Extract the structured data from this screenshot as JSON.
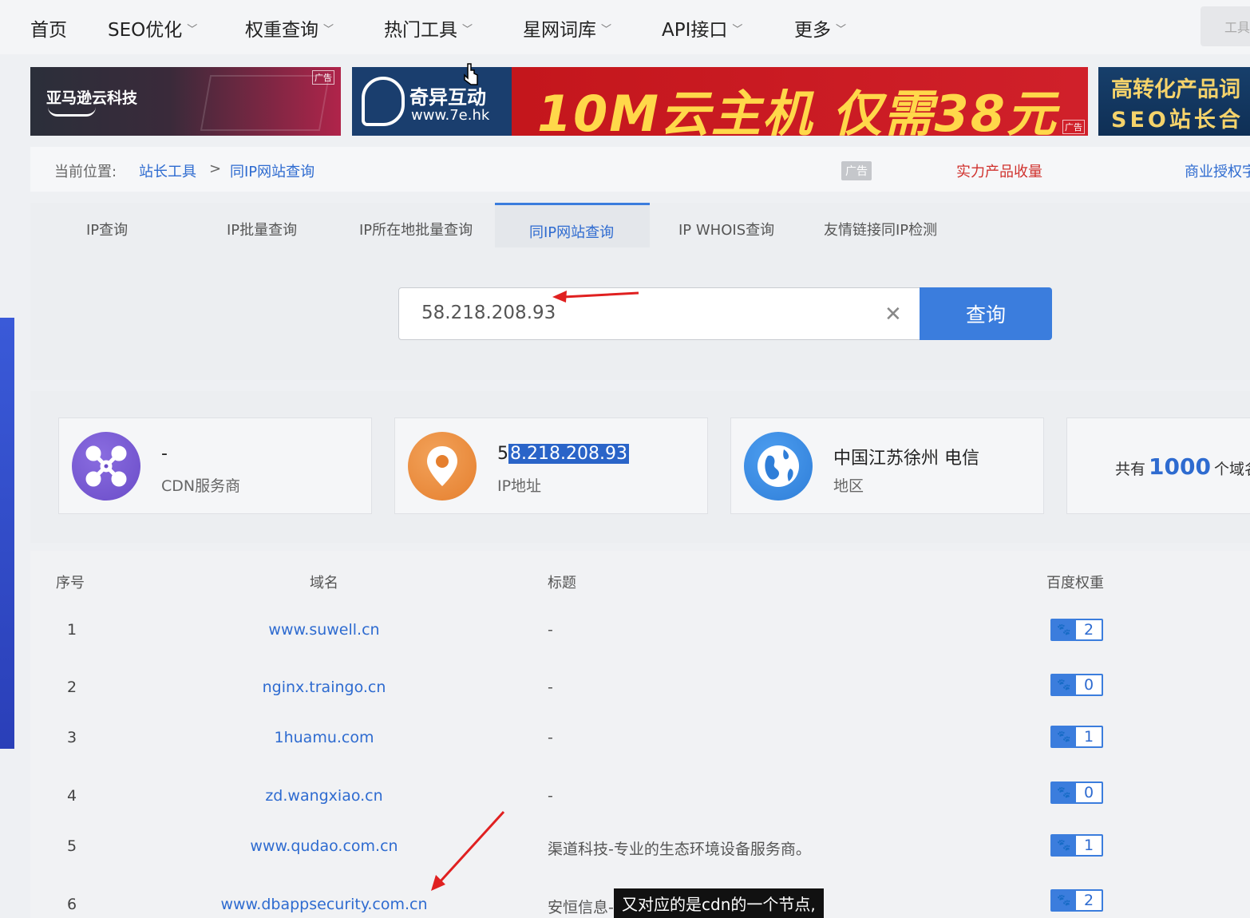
{
  "nav": {
    "items": [
      {
        "label": "首页",
        "has_dropdown": false
      },
      {
        "label": "SEO优化",
        "has_dropdown": true
      },
      {
        "label": "权重查询",
        "has_dropdown": true
      },
      {
        "label": "热门工具",
        "has_dropdown": true
      },
      {
        "label": "星网词库",
        "has_dropdown": true
      },
      {
        "label": "API接口",
        "has_dropdown": true
      },
      {
        "label": "更多",
        "has_dropdown": true
      }
    ],
    "tools_label": "工具"
  },
  "ads": {
    "amazon": {
      "brand": "亚马逊云科技",
      "tag": "广告"
    },
    "qiyi": {
      "logo_text": "奇异互动",
      "url": "www.7e.hk",
      "headline": "10M云主机 仅需38元",
      "tag": "广告"
    },
    "seo": {
      "line1": "高转化产品词",
      "line2": "SEO站长合"
    }
  },
  "breadcrumb": {
    "label": "当前位置:",
    "items": [
      "站长工具",
      "同IP网站查询"
    ],
    "separator": ">",
    "ad_tag": "广告",
    "promo": "实力产品收量",
    "biz": "商业授权字"
  },
  "tabs": [
    {
      "label": "IP查询",
      "active": false
    },
    {
      "label": "IP批量查询",
      "active": false
    },
    {
      "label": "IP所在地批量查询",
      "active": false
    },
    {
      "label": "同IP网站查询",
      "active": true
    },
    {
      "label": "IP WHOIS查询",
      "active": false
    },
    {
      "label": "友情链接同IP检测",
      "active": false
    }
  ],
  "search": {
    "value": "58.218.208.93",
    "button_label": "查询"
  },
  "cards": {
    "cdn": {
      "value": "-",
      "label": "CDN服务商"
    },
    "ip": {
      "value_prefix": "5",
      "value_highlight": "8.218.208.93",
      "label": "IP地址"
    },
    "region": {
      "value": "中国江苏徐州 电信",
      "label": "地区"
    },
    "count": {
      "prefix": "共有",
      "number": "1000",
      "suffix": "个域名"
    }
  },
  "table": {
    "headers": {
      "index": "序号",
      "domain": "域名",
      "title": "标题",
      "weight": "百度权重"
    },
    "rows": [
      {
        "index": "1",
        "domain": "www.suwell.cn",
        "title": "-",
        "weight": "2"
      },
      {
        "index": "2",
        "domain": "nginx.traingo.cn",
        "title": "-",
        "weight": "0"
      },
      {
        "index": "3",
        "domain": "1huamu.com",
        "title": "-",
        "weight": "1"
      },
      {
        "index": "4",
        "domain": "zd.wangxiao.cn",
        "title": "-",
        "weight": "0"
      },
      {
        "index": "5",
        "domain": "www.qudao.com.cn",
        "title": "渠道科技-专业的生态环境设备服务商。",
        "weight": "1"
      },
      {
        "index": "6",
        "domain": "www.dbappsecurity.com.cn",
        "title": "安恒信息-数据安全,云安全,物联网安全",
        "weight": "2"
      }
    ]
  },
  "subtitle": "又对应的是cdn的一个节点,",
  "colors": {
    "accent": "#3b7ddd",
    "link": "#2e6bd0",
    "promo": "#d0312d"
  }
}
